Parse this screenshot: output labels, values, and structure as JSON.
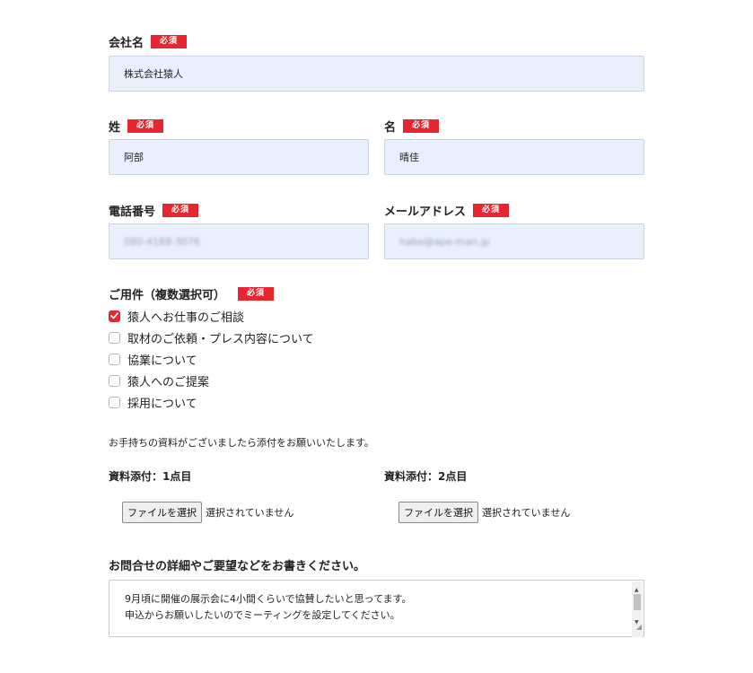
{
  "badge_text": "必須",
  "company": {
    "label": "会社名",
    "value": "株式会社猿人"
  },
  "last_name": {
    "label": "姓",
    "value": "阿部"
  },
  "first_name": {
    "label": "名",
    "value": "晴佳"
  },
  "phone": {
    "label": "電話番号",
    "value": "080-4188-3076"
  },
  "email": {
    "label": "メールアドレス",
    "value": "habe@ape-man.jp"
  },
  "inquiry": {
    "label": "ご用件（複数選択可）",
    "options": [
      {
        "label": "猿人へお仕事のご相談",
        "checked": true
      },
      {
        "label": "取材のご依頼・プレス内容について",
        "checked": false
      },
      {
        "label": "協業について",
        "checked": false
      },
      {
        "label": "猿人へのご提案",
        "checked": false
      },
      {
        "label": "採用について",
        "checked": false
      }
    ]
  },
  "attachment_note": "お手持ちの資料がございましたら添付をお願いいたします。",
  "attachment1": {
    "label": "資料添付：1点目",
    "button": "ファイルを選択",
    "status": "選択されていません"
  },
  "attachment2": {
    "label": "資料添付：2点目",
    "button": "ファイルを選択",
    "status": "選択されていません"
  },
  "details": {
    "label": "お問合せの詳細やご要望などをお書きください。",
    "line1": "9月頃に開催の展示会に4小間くらいで協賛したいと思ってます。",
    "line2": "申込からお願いしたいのでミーティングを設定してください。"
  },
  "colors": {
    "accent": "#e8262f",
    "input_bg": "#e8f0fe"
  },
  "icons": {
    "checkbox_checked": "checkmark-icon",
    "textarea_resize": "resize-grip-icon"
  }
}
